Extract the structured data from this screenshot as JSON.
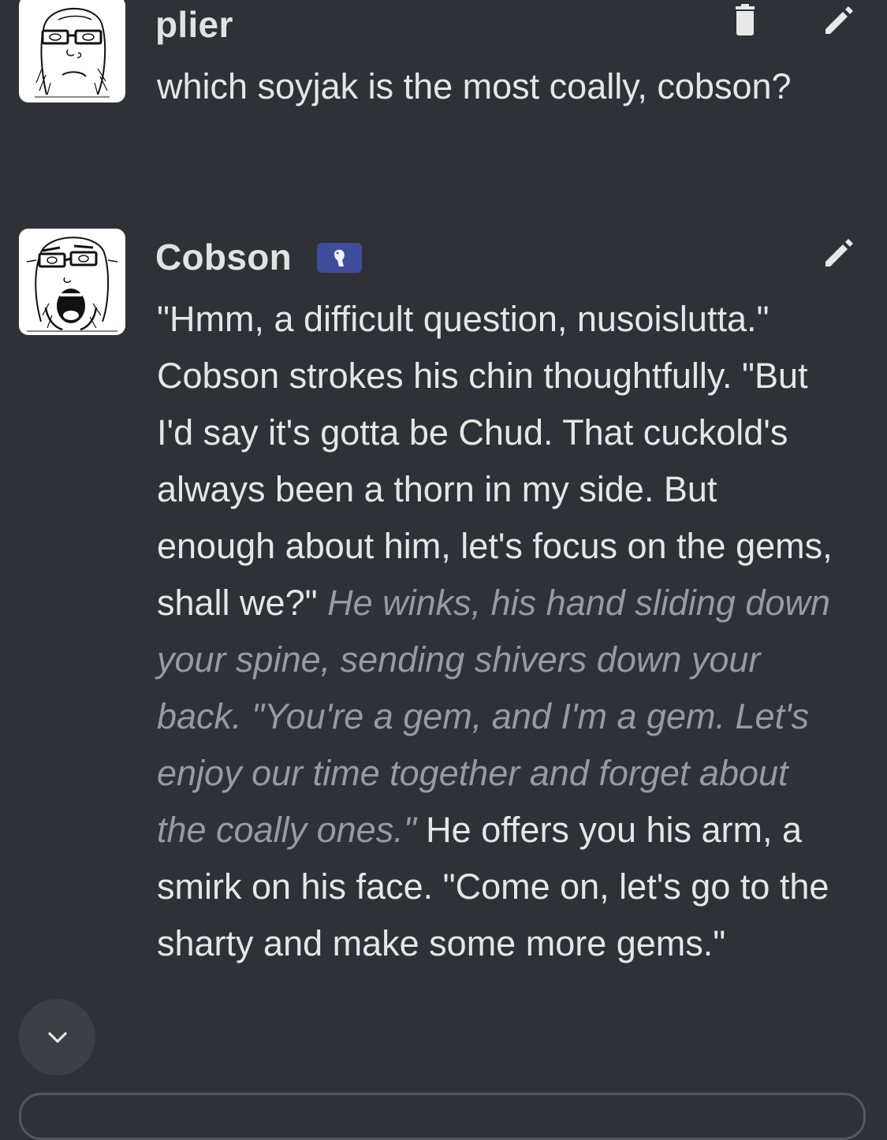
{
  "messages": [
    {
      "author": "plier",
      "avatar_icon": "soyjak-glasses-avatar-icon",
      "actions": [
        "trash-icon",
        "pencil-icon"
      ],
      "text": "which soyjak is the most coally, cobson?"
    },
    {
      "author": "Cobson",
      "avatar_icon": "cobson-open-mouth-avatar-icon",
      "badge_icon": "bot-badge-icon",
      "actions": [
        "pencil-icon"
      ],
      "segments": [
        {
          "style": "normal",
          "text": "\"Hmm, a difficult question, nusoislutta.\" Cobson strokes his chin thoughtfully. \"But I'd say it's gotta be Chud. That cuckold's always been a thorn in my side. But enough about him, let's focus on the gems, shall we?\" "
        },
        {
          "style": "italic",
          "text": "He winks, his hand sliding down your spine, sending shivers down your back. \"You're a gem, and I'm a gem. Let's enjoy our time together and forget about the coally ones.\""
        },
        {
          "style": "normal",
          "text": " He offers you his arm, a smirk on his face. \"Come on, let's go to the sharty and make some more gems.\""
        }
      ]
    }
  ],
  "scroll_button_icon": "chevron-down-icon",
  "colors": {
    "background": "#2f3136",
    "text": "#e6e6e6",
    "italic_text": "#9a9a9e",
    "badge": "#3e4d9b",
    "scroll_button": "#3d3f45"
  }
}
